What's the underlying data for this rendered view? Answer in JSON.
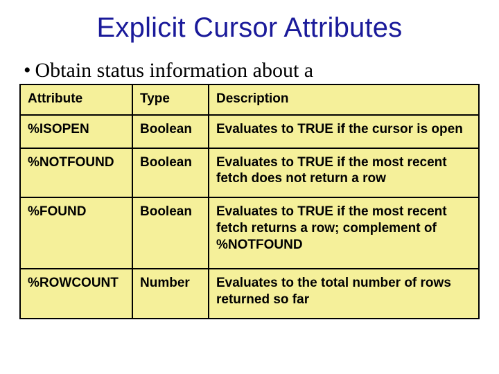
{
  "title": "Explicit Cursor Attributes",
  "bullet": "Obtain status information about a",
  "table": {
    "headers": {
      "attribute": "Attribute",
      "type": "Type",
      "description": "Description"
    },
    "rows": [
      {
        "attribute": "%ISOPEN",
        "type": "Boolean",
        "description": "Evaluates to TRUE if the cursor is open"
      },
      {
        "attribute": "%NOTFOUND",
        "type": "Boolean",
        "description": "Evaluates to TRUE if the most recent fetch does not return a row"
      },
      {
        "attribute": "%FOUND",
        "type": "Boolean",
        "description": "Evaluates to TRUE if the most recent fetch returns a row; complement of %NOTFOUND"
      },
      {
        "attribute": "%ROWCOUNT",
        "type": "Number",
        "description": "Evaluates to the total number of rows returned so far"
      }
    ]
  }
}
